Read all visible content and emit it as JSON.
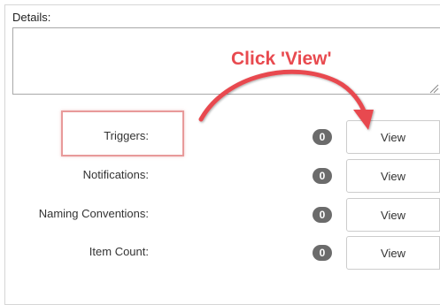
{
  "details": {
    "label": "Details:",
    "value": ""
  },
  "annotation": {
    "text": "Click 'View'",
    "color": "#e84a4f"
  },
  "rows": [
    {
      "label": "Triggers:",
      "count": "0",
      "button": "View"
    },
    {
      "label": "Notifications:",
      "count": "0",
      "button": "View"
    },
    {
      "label": "Naming Conventions:",
      "count": "0",
      "button": "View"
    },
    {
      "label": "Item Count:",
      "count": "0",
      "button": "View"
    }
  ],
  "colors": {
    "badge": "#6b6b6b",
    "highlight": "#e89a9a"
  }
}
